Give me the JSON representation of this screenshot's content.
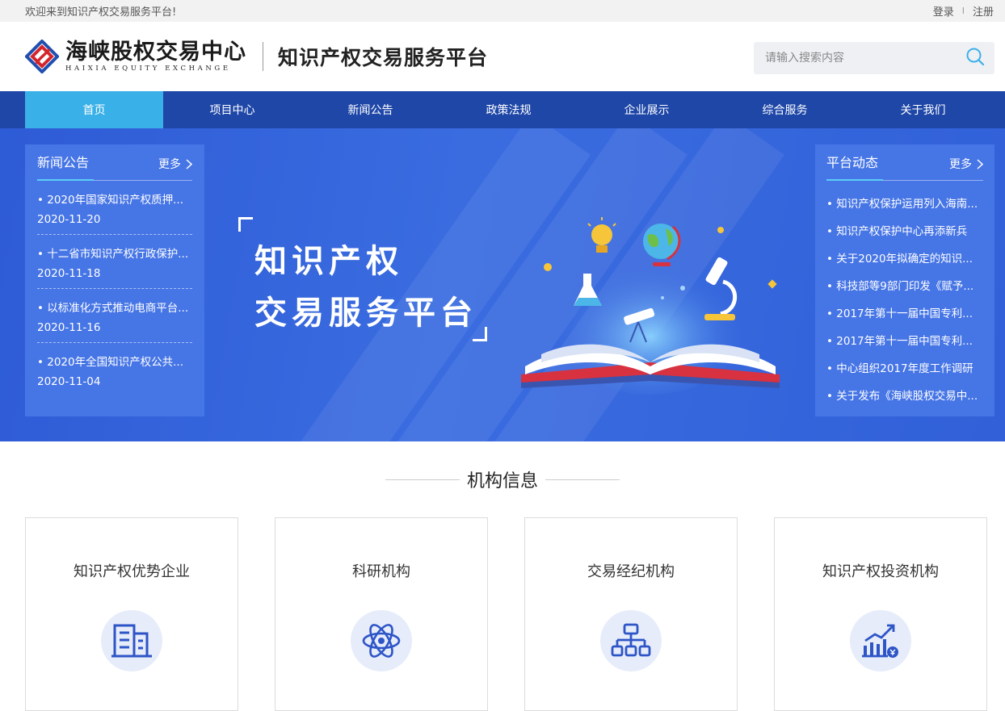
{
  "topbar": {
    "welcome": "欢迎来到知识产权交易服务平台!",
    "login": "登录",
    "sep": "I",
    "register": "注册"
  },
  "header": {
    "logo_cn": "海峡股权交易中心",
    "logo_en": "HAIXIA EQUITY EXCHANGE",
    "platform_title": "知识产权交易服务平台",
    "search_placeholder": "请输入搜索内容"
  },
  "nav": [
    "首页",
    "项目中心",
    "新闻公告",
    "政策法规",
    "企业展示",
    "综合服务",
    "关于我们"
  ],
  "news": {
    "title": "新闻公告",
    "more": "更多",
    "items": [
      {
        "title": "• 2020年国家知识产权质押...",
        "date": "2020-11-20"
      },
      {
        "title": "• 十二省市知识产权行政保护...",
        "date": "2020-11-18"
      },
      {
        "title": "• 以标准化方式推动电商平台...",
        "date": "2020-11-16"
      },
      {
        "title": "• 2020年全国知识产权公共...",
        "date": "2020-11-04"
      }
    ]
  },
  "hero": {
    "line1": "知识产权",
    "line2": "交易服务平台"
  },
  "dynamics": {
    "title": "平台动态",
    "more": "更多",
    "items": [
      "• 知识产权保护运用列入海南...",
      "• 知识产权保护中心再添新兵",
      "• 关于2020年拟确定的知识...",
      "• 科技部等9部门印发《赋予...",
      "• 2017年第十一届中国专利...",
      "• 2017年第十一届中国专利...",
      "• 中心组织2017年度工作调研",
      "• 关于发布《海峡股权交易中..."
    ]
  },
  "section": {
    "title": "机构信息"
  },
  "cards": [
    {
      "name": "知识产权优势企业",
      "icon": "building-icon"
    },
    {
      "name": "科研机构",
      "icon": "atom-icon"
    },
    {
      "name": "交易经纪机构",
      "icon": "org-chart-icon"
    },
    {
      "name": "知识产权投资机构",
      "icon": "investment-chart-icon"
    }
  ],
  "colors": {
    "nav": "#1f47a8",
    "nav_active": "#3ab0e8",
    "banner": "#3160d8",
    "panel": "#4675e6",
    "icon": "#2e55c7"
  }
}
